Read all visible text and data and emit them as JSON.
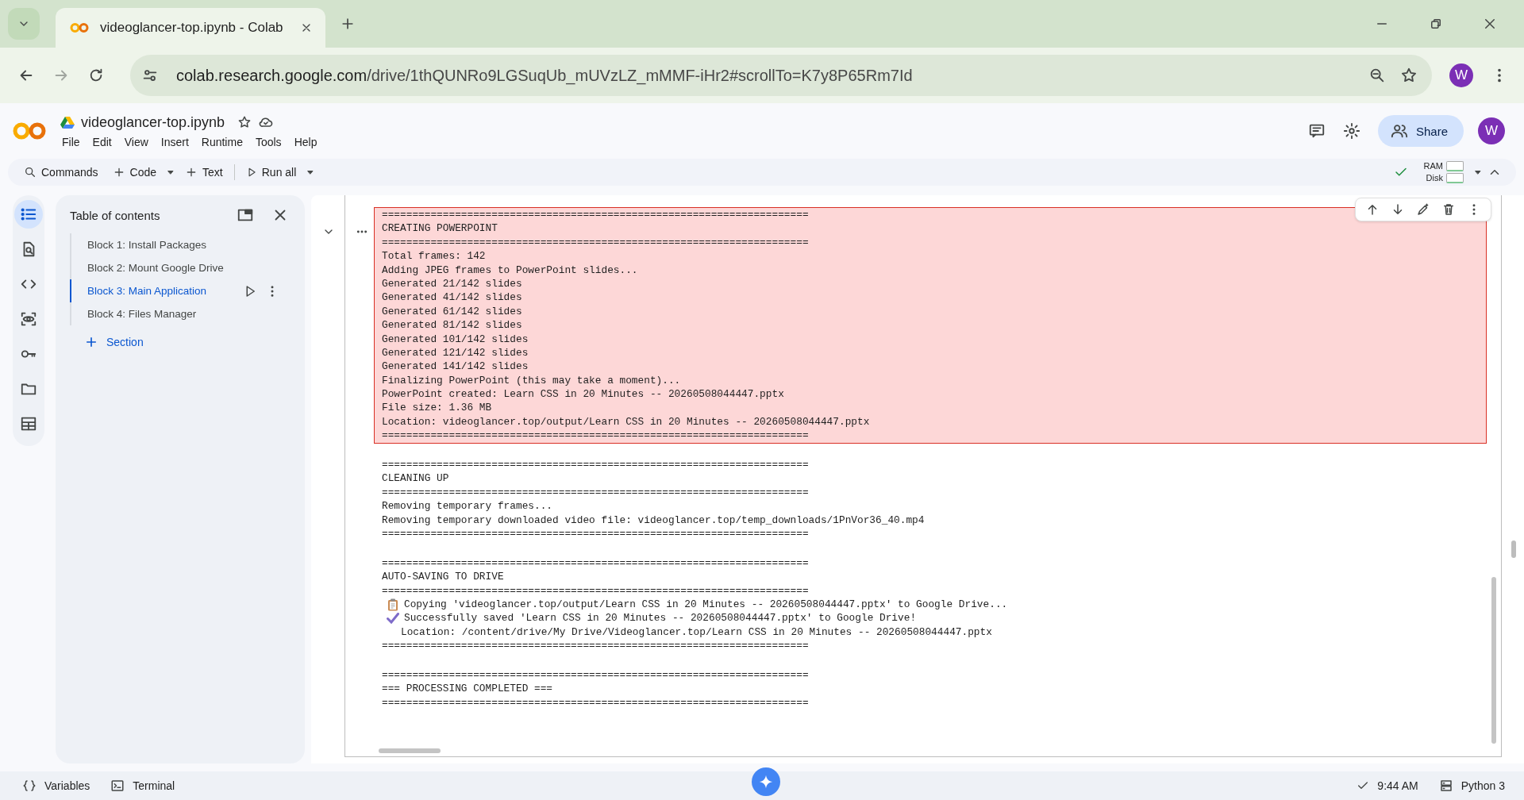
{
  "browser": {
    "tab_title": "videoglancer-top.ipynb - Colab",
    "url_host": "colab.research.google.com",
    "url_path": "/drive/1thQUNRo9LGSuqUb_mUVzLZ_mMMF-iHr2#scrollTo=K7y8P65Rm7Id",
    "profile_initial": "W"
  },
  "notebook": {
    "title": "videoglancer-top.ipynb",
    "menu": [
      "File",
      "Edit",
      "View",
      "Insert",
      "Runtime",
      "Tools",
      "Help"
    ],
    "share_label": "Share",
    "avatar_initial": "W"
  },
  "toolbar": {
    "commands": "Commands",
    "code": "Code",
    "text": "Text",
    "run_all": "Run all",
    "ram_label": "RAM",
    "disk_label": "Disk"
  },
  "rail": [
    {
      "kind": "toc",
      "selected": true
    },
    {
      "kind": "find",
      "selected": false
    },
    {
      "kind": "code",
      "selected": false
    },
    {
      "kind": "eye",
      "selected": false
    },
    {
      "kind": "key",
      "selected": false
    },
    {
      "kind": "folder",
      "selected": false
    },
    {
      "kind": "table",
      "selected": false
    }
  ],
  "toc": {
    "title": "Table of contents",
    "items": [
      {
        "label": "Block 1: Install Packages",
        "selected": false
      },
      {
        "label": "Block 2: Mount Google Drive",
        "selected": false
      },
      {
        "label": "Block 3: Main Application",
        "selected": true
      },
      {
        "label": "Block 4: Files Manager",
        "selected": false
      }
    ],
    "add_section": "Section"
  },
  "output": {
    "groups": [
      {
        "highlighted": true,
        "lines": [
          {
            "text": "======================================================================"
          },
          {
            "text": "CREATING POWERPOINT"
          },
          {
            "text": "======================================================================"
          },
          {
            "text": "Total frames: 142"
          },
          {
            "text": "Adding JPEG frames to PowerPoint slides..."
          },
          {
            "text": "Generated 21/142 slides"
          },
          {
            "text": "Generated 41/142 slides"
          },
          {
            "text": "Generated 61/142 slides"
          },
          {
            "text": "Generated 81/142 slides"
          },
          {
            "text": "Generated 101/142 slides"
          },
          {
            "text": "Generated 121/142 slides"
          },
          {
            "text": "Generated 141/142 slides"
          },
          {
            "text": "Finalizing PowerPoint (this may take a moment)..."
          },
          {
            "text": "PowerPoint created: Learn CSS in 20 Minutes -- 20260508044447.pptx"
          },
          {
            "text": "File size: 1.36 MB"
          },
          {
            "text": "Location: videoglancer.top/output/Learn CSS in 20 Minutes -- 20260508044447.pptx"
          },
          {
            "text": "======================================================================"
          }
        ]
      },
      {
        "highlighted": false,
        "lines": [
          {
            "text": "======================================================================"
          },
          {
            "text": "CLEANING UP"
          },
          {
            "text": "======================================================================"
          },
          {
            "text": "Removing temporary frames..."
          },
          {
            "text": "Removing temporary downloaded video file: videoglancer.top/temp_downloads/1PnVor36_40.mp4"
          },
          {
            "text": "======================================================================"
          }
        ]
      },
      {
        "highlighted": false,
        "lines": [
          {
            "text": "======================================================================"
          },
          {
            "text": "AUTO-SAVING TO DRIVE"
          },
          {
            "text": "======================================================================"
          },
          {
            "text": "Copying 'videoglancer.top/output/Learn CSS in 20 Minutes -- 20260508044447.pptx' to Google Drive...",
            "kind": "clipboard"
          },
          {
            "text": "Successfully saved 'Learn CSS in 20 Minutes -- 20260508044447.pptx' to Google Drive!",
            "kind": "check"
          },
          {
            "text": "Location: /content/drive/My Drive/Videoglancer.top/Learn CSS in 20 Minutes -- 20260508044447.pptx",
            "kind": "indented"
          },
          {
            "text": "======================================================================"
          }
        ]
      },
      {
        "highlighted": false,
        "lines": [
          {
            "text": "======================================================================"
          },
          {
            "text": "=== PROCESSING COMPLETED ==="
          },
          {
            "text": "======================================================================"
          }
        ]
      }
    ]
  },
  "status_bar": {
    "variables": "Variables",
    "terminal": "Terminal",
    "time": "9:44 AM",
    "runtime": "Python 3"
  }
}
